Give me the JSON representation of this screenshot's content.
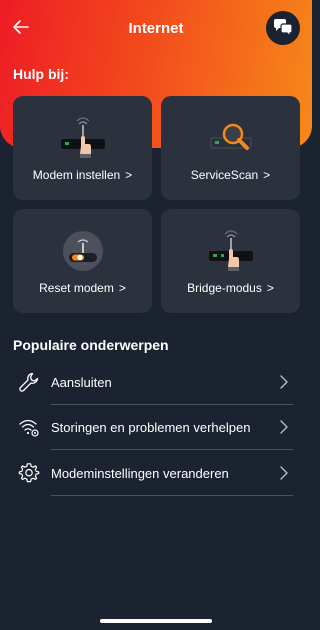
{
  "header": {
    "title": "Internet",
    "back_icon": "arrow-left-icon",
    "chat_icon": "chat-bubbles-icon"
  },
  "help": {
    "heading": "Hulp bij:",
    "tiles": [
      {
        "label": "Modem instellen",
        "icon": "modem-hand-icon"
      },
      {
        "label": "ServiceScan",
        "icon": "modem-magnifier-icon"
      },
      {
        "label": "Reset modem",
        "icon": "modem-reset-toggle-icon"
      },
      {
        "label": "Bridge-modus",
        "icon": "modem-bridge-icon"
      }
    ],
    "chevron": ">"
  },
  "topics": {
    "heading": "Populaire onderwerpen",
    "items": [
      {
        "label": "Aansluiten",
        "icon": "wrench-icon"
      },
      {
        "label": "Storingen en problemen verhelpen",
        "icon": "wifi-settings-icon"
      },
      {
        "label": "Modeminstellingen veranderen",
        "icon": "gear-icon"
      }
    ]
  },
  "colors": {
    "background": "#1b2230",
    "tile": "#2b323e",
    "accent_red": "#ee1c25",
    "accent_orange": "#f7891a"
  }
}
